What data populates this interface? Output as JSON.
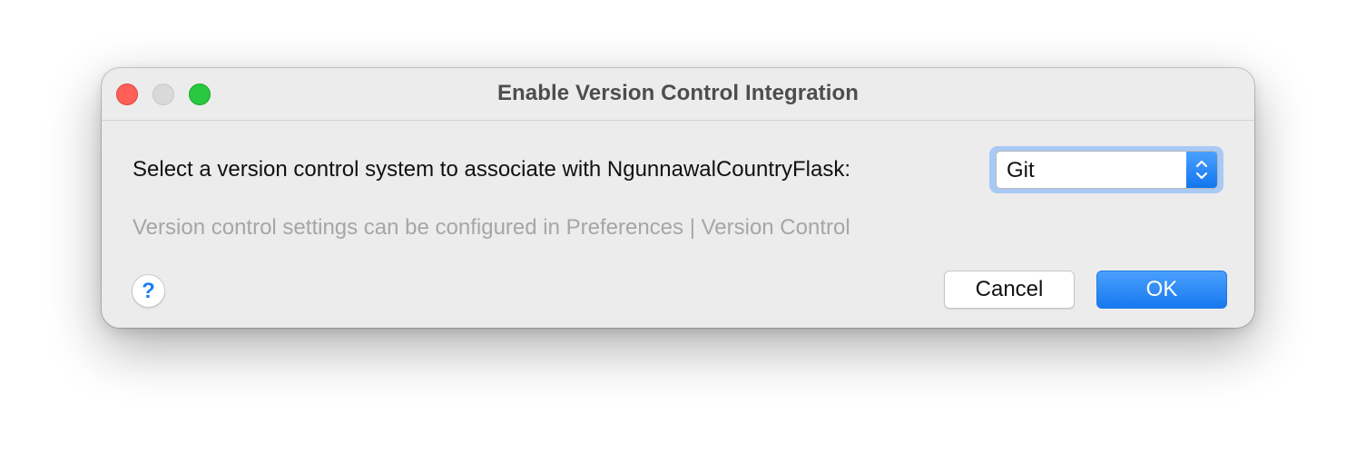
{
  "window": {
    "title": "Enable Version Control Integration",
    "controls": {
      "close_color": "#fe5f57",
      "minimize_color": "#d9d9d9",
      "zoom_color": "#28c840"
    }
  },
  "prompt": {
    "label": "Select a version control system to associate with NgunnawalCountryFlask:"
  },
  "vcs_select": {
    "selected": "Git",
    "icon": "up-down-chevrons-icon",
    "accent": "#1779f0"
  },
  "hint": {
    "text": "Version control settings can be configured in Preferences | Version Control"
  },
  "footer": {
    "help_label": "?",
    "cancel_label": "Cancel",
    "ok_label": "OK"
  }
}
